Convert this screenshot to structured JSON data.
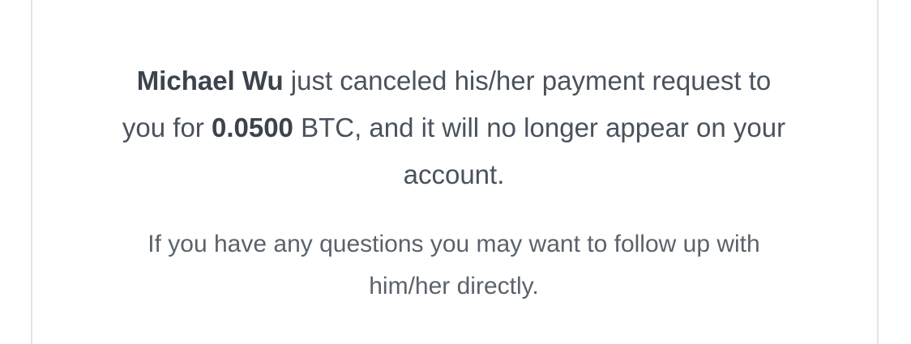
{
  "notification": {
    "sender_name": "Michael Wu",
    "text_1": "just canceled his/her payment request to you for",
    "amount": "0.0500",
    "currency": "BTC",
    "text_2": ", and it will no longer appear on your account.",
    "followup": "If you have any questions you may want to follow up with him/her directly."
  }
}
